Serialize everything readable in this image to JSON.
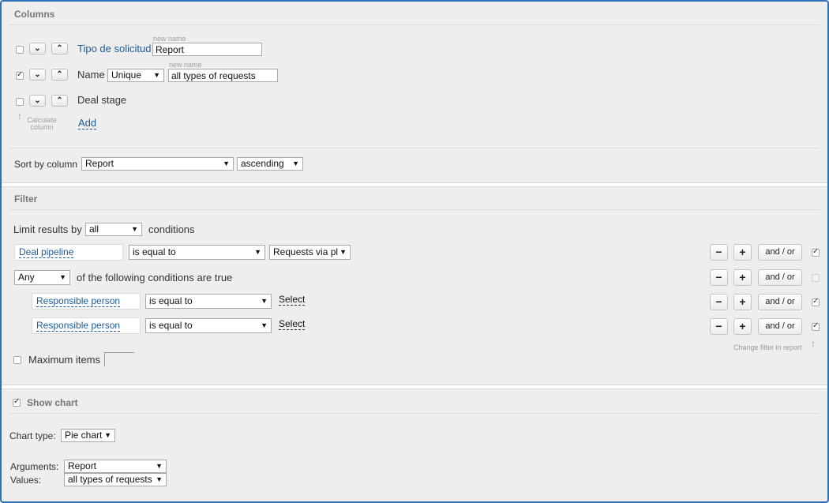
{
  "columns": {
    "title": "Columns",
    "rows": [
      {
        "label": "Tipo de solicitud",
        "new_name_caption": "new name",
        "new_name_value": "Report",
        "checked": false
      },
      {
        "label": "Name",
        "aggregate": "Unique",
        "new_name_caption": "new name",
        "new_name_value": "all types of requests",
        "checked": true
      },
      {
        "label": "Deal stage",
        "checked": false
      }
    ],
    "calc_label": "Calculate column",
    "add_label": "Add",
    "sort_label": "Sort by column",
    "sort_value": "Report",
    "sort_order": "ascending"
  },
  "filter": {
    "title": "Filter",
    "limit_label": "Limit results by",
    "limit_value": "all",
    "conditions_label": "conditions",
    "cond1": {
      "field": "Deal pipeline",
      "operator": "is equal to",
      "value": "Requests via pl"
    },
    "group": {
      "mode": "Any",
      "text": "of the following conditions are true"
    },
    "cond2": {
      "field": "Responsible person",
      "operator": "is equal to",
      "value": "Select"
    },
    "cond3": {
      "field": "Responsible person",
      "operator": "is equal to",
      "value": "Select"
    },
    "minus": "−",
    "plus": "+",
    "andor": "and / or",
    "change_filter_label": "Change filter in report",
    "max_items_label": "Maximum items"
  },
  "chart": {
    "title": "Show chart",
    "type_label": "Chart type:",
    "type_value": "Pie chart",
    "args_label": "Arguments:",
    "args_value": "Report",
    "values_label": "Values:",
    "values_value": "all types of requests"
  }
}
